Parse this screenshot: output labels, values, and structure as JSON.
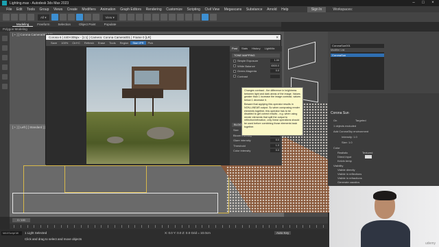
{
  "window": {
    "title": "Lighting.max - Autodesk 3ds Max 2023"
  },
  "menu": [
    "File",
    "Edit",
    "Tools",
    "Group",
    "Views",
    "Create",
    "Modifiers",
    "Animation",
    "Graph Editors",
    "Rendering",
    "Customize",
    "Scripting",
    "Civil View",
    "Megascans",
    "Substance",
    "Arnold",
    "Help"
  ],
  "account": {
    "signin": "Sign In",
    "workspace": "Workspaces:"
  },
  "ribbon": {
    "tabs": [
      "Modeling",
      "Freeform",
      "Selection",
      "Object Paint",
      "Populate"
    ],
    "active": "Modeling",
    "sub": "Polygon Modeling"
  },
  "viewports": {
    "top_label": "[ + ] [ Corona Camera001 ] [ ]",
    "front_label": "[ + ] [ Left ] [ Standard ] [ ]"
  },
  "vfb": {
    "title": "Corona 6 | 440×305px - [1:1] | Camera: Corona Camera001 | Frame 0 [LR]",
    "toolbar": [
      "Save",
      "100%",
      "Ctrl+C",
      "Refresh",
      "Erase",
      "Tools",
      "Region",
      "Start IPR",
      "Pick"
    ],
    "side_tabs": [
      "Post",
      "Stats",
      "History",
      "LightMix"
    ],
    "section_tone": "TONE MAPPING",
    "rows": [
      {
        "label": "Simple Exposure",
        "value": "1.00",
        "checked": true
      },
      {
        "label": "White Balance",
        "value": "6500.0",
        "checked": true
      },
      {
        "label": "Green-Magenta",
        "value": "0.0",
        "checked": true
      },
      {
        "label": "Contrast",
        "value": "",
        "checked": true
      }
    ],
    "section_bloom": "BLOOM AND GLARE",
    "bloom_rows": [
      {
        "label": "Size",
        "value": "15.0"
      },
      {
        "label": "Bloom intensity",
        "value": "0.0"
      },
      {
        "label": "Glare intensity",
        "value": "0.0"
      },
      {
        "label": "Threshold",
        "value": "1.0"
      },
      {
        "label": "Color intensity",
        "value": "0.0"
      }
    ]
  },
  "tooltip": {
    "p1": "Changes contrast - the difference in brightness between light and dark areas of the image. Values greater than 1 increase the image contrast, values below 1 decrease it.",
    "p2": "Beware that applying this operator results in NON-LINEAR output. So when composing render elements together, this operator has to be disabled to get correct results - e.g. when using render elements that split the output to reflection/refraction, only linear operations should be used before combining those elements back together."
  },
  "command_panel": {
    "object_name": "CoronaSun001",
    "modifier_list": "Modifier List",
    "stack_item": "CoronaSun",
    "rollout": "Corona Sun",
    "props": [
      "On",
      "Targeted",
      "1 objects excluded",
      "Add CoronaSky environment",
      "Intensity: 1.0",
      "Size: 1.0",
      "Color",
      "Realistic",
      "Textured",
      "Direct input",
      "Kelvin temp",
      "Visibility",
      "Visible directly",
      "Visible in reflections",
      "Visible in refractions",
      "Generate caustics"
    ]
  },
  "timeline": {
    "slider": "0 / 100"
  },
  "status": {
    "maxscript": "MAXScript Mi",
    "line1": "1 Light Selected",
    "line2": "Click and drag to select and move objects",
    "coords": "X: 0.0   Y: 0.0   Z: 0.0   Grid = 10.0cm",
    "autokey": "Auto Key",
    "selected": "Selected"
  },
  "webcam": {
    "brand": "udemy"
  },
  "colors": {
    "accent": "#2f6fb2",
    "tooltip_bg": "#fbf8c8",
    "wire": "#d9b94a"
  }
}
